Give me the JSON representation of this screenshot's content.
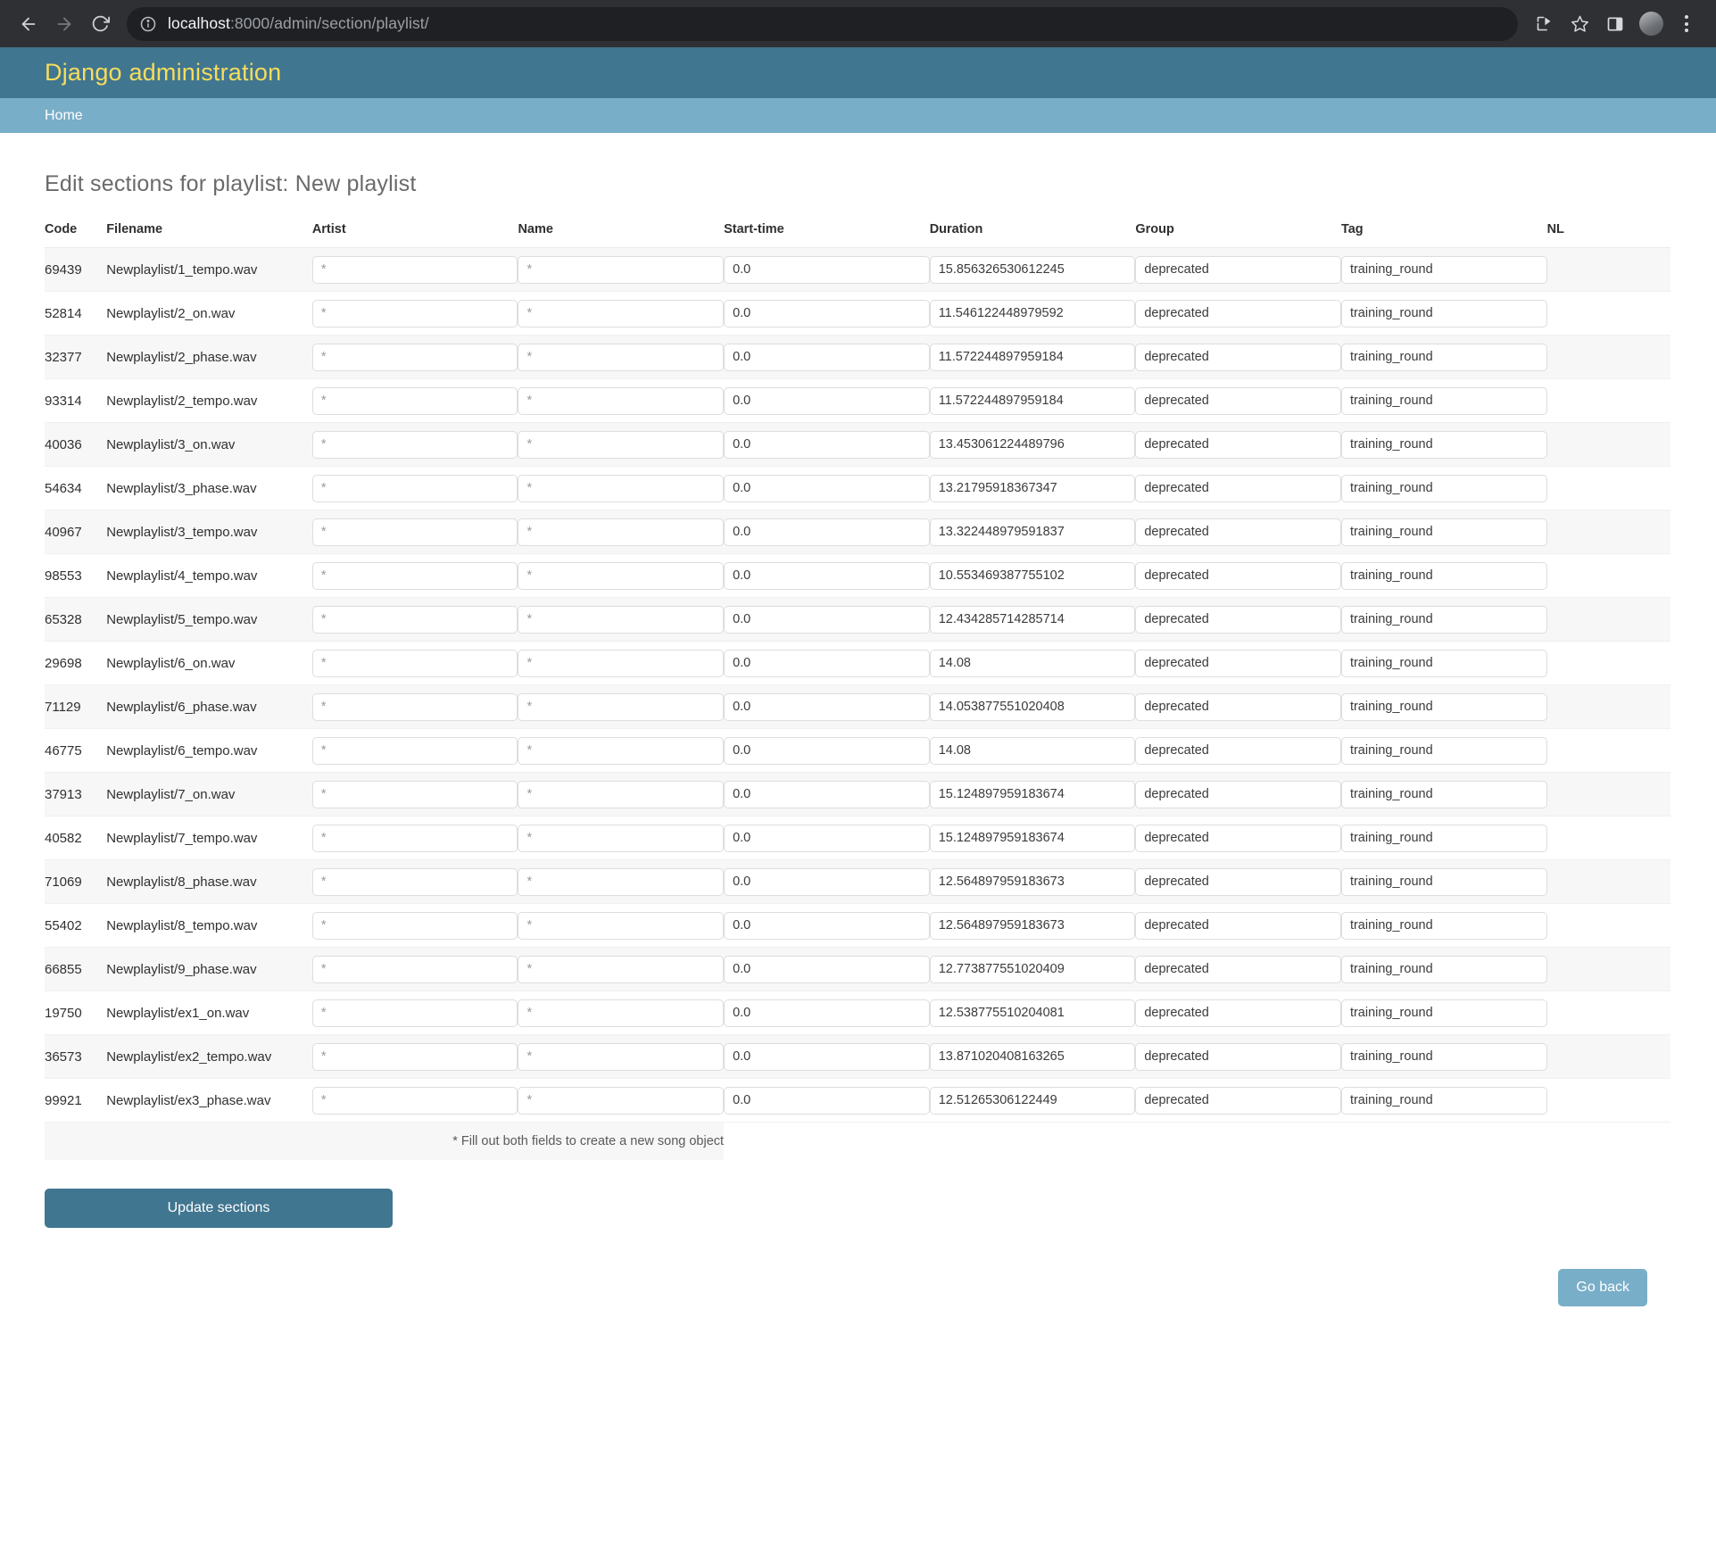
{
  "browser": {
    "back_icon": "arrow-left-icon",
    "forward_icon": "arrow-right-icon",
    "reload_icon": "reload-icon",
    "info_icon": "info-circle-icon",
    "url_host": "localhost",
    "url_path": ":8000/admin/section/playlist/",
    "share_icon": "share-icon",
    "bookmark_icon": "star-icon",
    "sidebar_icon": "side-panel-icon",
    "profile_icon": "avatar-icon",
    "menu_icon": "kebab-menu-icon"
  },
  "site": {
    "title": "Django administration",
    "breadcrumb_home": "Home",
    "header_color": "#417690",
    "breadcrumb_color": "#79aec8",
    "title_color": "#f5dd5d"
  },
  "main": {
    "page_title": "Edit sections for playlist: New playlist",
    "columns": [
      "Code",
      "Filename",
      "Artist",
      "Name",
      "Start-time",
      "Duration",
      "Group",
      "Tag",
      "NL"
    ],
    "footer_note": "* Fill out both fields to create a new song object",
    "update_button": "Update sections",
    "go_back_button": "Go back",
    "placeholders": {
      "artist": "*",
      "name": "*"
    },
    "rows": [
      {
        "code": "69439",
        "filename": "Newplaylist/1_tempo.wav",
        "artist": "",
        "name": "",
        "start": "0.0",
        "duration": "15.856326530612245",
        "group": "deprecated",
        "tag": "training_round",
        "nl": ""
      },
      {
        "code": "52814",
        "filename": "Newplaylist/2_on.wav",
        "artist": "",
        "name": "",
        "start": "0.0",
        "duration": "11.546122448979592",
        "group": "deprecated",
        "tag": "training_round",
        "nl": ""
      },
      {
        "code": "32377",
        "filename": "Newplaylist/2_phase.wav",
        "artist": "",
        "name": "",
        "start": "0.0",
        "duration": "11.572244897959184",
        "group": "deprecated",
        "tag": "training_round",
        "nl": ""
      },
      {
        "code": "93314",
        "filename": "Newplaylist/2_tempo.wav",
        "artist": "",
        "name": "",
        "start": "0.0",
        "duration": "11.572244897959184",
        "group": "deprecated",
        "tag": "training_round",
        "nl": ""
      },
      {
        "code": "40036",
        "filename": "Newplaylist/3_on.wav",
        "artist": "",
        "name": "",
        "start": "0.0",
        "duration": "13.453061224489796",
        "group": "deprecated",
        "tag": "training_round",
        "nl": ""
      },
      {
        "code": "54634",
        "filename": "Newplaylist/3_phase.wav",
        "artist": "",
        "name": "",
        "start": "0.0",
        "duration": "13.21795918367347",
        "group": "deprecated",
        "tag": "training_round",
        "nl": ""
      },
      {
        "code": "40967",
        "filename": "Newplaylist/3_tempo.wav",
        "artist": "",
        "name": "",
        "start": "0.0",
        "duration": "13.322448979591837",
        "group": "deprecated",
        "tag": "training_round",
        "nl": ""
      },
      {
        "code": "98553",
        "filename": "Newplaylist/4_tempo.wav",
        "artist": "",
        "name": "",
        "start": "0.0",
        "duration": "10.553469387755102",
        "group": "deprecated",
        "tag": "training_round",
        "nl": ""
      },
      {
        "code": "65328",
        "filename": "Newplaylist/5_tempo.wav",
        "artist": "",
        "name": "",
        "start": "0.0",
        "duration": "12.434285714285714",
        "group": "deprecated",
        "tag": "training_round",
        "nl": ""
      },
      {
        "code": "29698",
        "filename": "Newplaylist/6_on.wav",
        "artist": "",
        "name": "",
        "start": "0.0",
        "duration": "14.08",
        "group": "deprecated",
        "tag": "training_round",
        "nl": ""
      },
      {
        "code": "71129",
        "filename": "Newplaylist/6_phase.wav",
        "artist": "",
        "name": "",
        "start": "0.0",
        "duration": "14.053877551020408",
        "group": "deprecated",
        "tag": "training_round",
        "nl": ""
      },
      {
        "code": "46775",
        "filename": "Newplaylist/6_tempo.wav",
        "artist": "",
        "name": "",
        "start": "0.0",
        "duration": "14.08",
        "group": "deprecated",
        "tag": "training_round",
        "nl": ""
      },
      {
        "code": "37913",
        "filename": "Newplaylist/7_on.wav",
        "artist": "",
        "name": "",
        "start": "0.0",
        "duration": "15.124897959183674",
        "group": "deprecated",
        "tag": "training_round",
        "nl": ""
      },
      {
        "code": "40582",
        "filename": "Newplaylist/7_tempo.wav",
        "artist": "",
        "name": "",
        "start": "0.0",
        "duration": "15.124897959183674",
        "group": "deprecated",
        "tag": "training_round",
        "nl": ""
      },
      {
        "code": "71069",
        "filename": "Newplaylist/8_phase.wav",
        "artist": "",
        "name": "",
        "start": "0.0",
        "duration": "12.564897959183673",
        "group": "deprecated",
        "tag": "training_round",
        "nl": ""
      },
      {
        "code": "55402",
        "filename": "Newplaylist/8_tempo.wav",
        "artist": "",
        "name": "",
        "start": "0.0",
        "duration": "12.564897959183673",
        "group": "deprecated",
        "tag": "training_round",
        "nl": ""
      },
      {
        "code": "66855",
        "filename": "Newplaylist/9_phase.wav",
        "artist": "",
        "name": "",
        "start": "0.0",
        "duration": "12.773877551020409",
        "group": "deprecated",
        "tag": "training_round",
        "nl": ""
      },
      {
        "code": "19750",
        "filename": "Newplaylist/ex1_on.wav",
        "artist": "",
        "name": "",
        "start": "0.0",
        "duration": "12.538775510204081",
        "group": "deprecated",
        "tag": "training_round",
        "nl": ""
      },
      {
        "code": "36573",
        "filename": "Newplaylist/ex2_tempo.wav",
        "artist": "",
        "name": "",
        "start": "0.0",
        "duration": "13.871020408163265",
        "group": "deprecated",
        "tag": "training_round",
        "nl": ""
      },
      {
        "code": "99921",
        "filename": "Newplaylist/ex3_phase.wav",
        "artist": "",
        "name": "",
        "start": "0.0",
        "duration": "12.51265306122449",
        "group": "deprecated",
        "tag": "training_round",
        "nl": ""
      }
    ]
  }
}
